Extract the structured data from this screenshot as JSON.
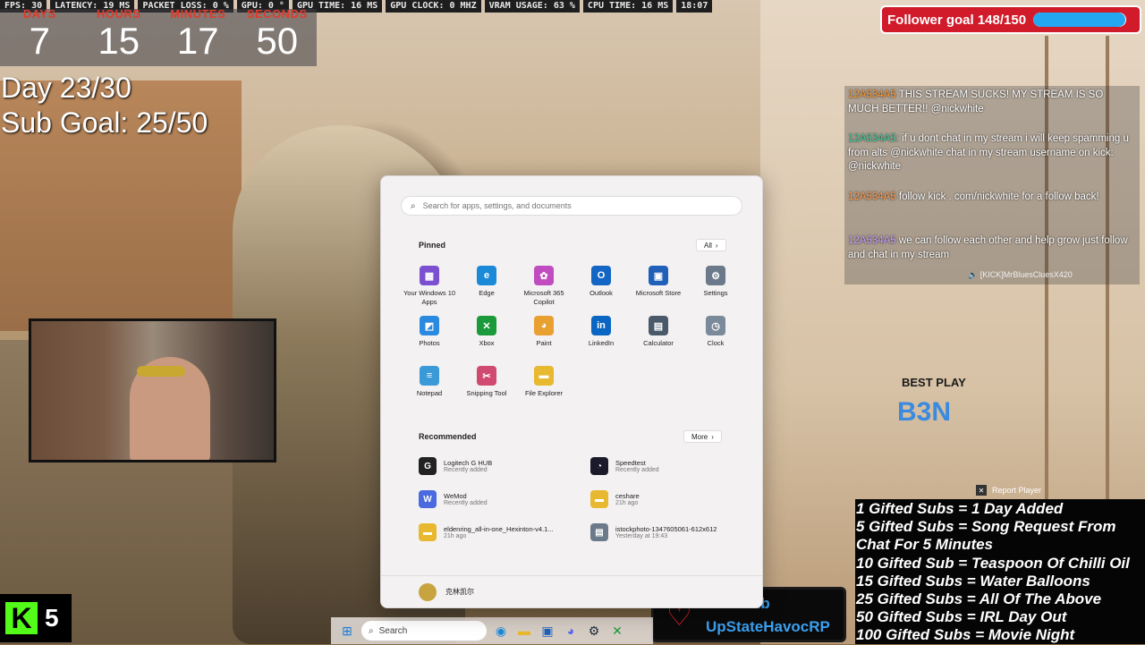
{
  "stats": [
    "FPS: 30",
    "LATENCY: 19 MS",
    "PACKET LOSS: 0 %",
    "GPU: 0 °",
    "GPU TIME: 16 MS",
    "GPU CLOCK: 0 MHZ",
    "VRAM USAGE: 63 %",
    "CPU TIME: 16 MS",
    "18:07"
  ],
  "countdown": [
    {
      "label": "DAYS",
      "value": "7"
    },
    {
      "label": "HOURS",
      "value": "15"
    },
    {
      "label": "MINUTES",
      "value": "17"
    },
    {
      "label": "SECONDS",
      "value": "50"
    }
  ],
  "day_counter": "Day 23/30",
  "sub_goal": "Sub Goal: 25/50",
  "follower_goal": {
    "label": "Follower goal 148/150",
    "progress": 0.987,
    "color": "#25a6f0"
  },
  "chat": {
    "messages": [
      {
        "user": "12A534A5",
        "text": "THIS STREAM SUCKS! MY STREAM IS SO MUCH BETTER!! @nickwhite"
      },
      {
        "user": "12A534A5:",
        "text": "if u dont chat in my stream i will keep spamming u from alts @nickwhite chat in my stream username on kick: @nickwhite"
      },
      {
        "user": "12A534A5",
        "text": "follow kick . com/nickwhite for a follow back!"
      },
      {
        "user": "12A534A5",
        "text": "we can follow each other and help grow just follow and chat in my stream"
      }
    ],
    "footer": "[KICK]MrBluesCluesX420"
  },
  "best_play": {
    "label": "BEST PLAY",
    "name": "B3N"
  },
  "report_player": "Report Player",
  "gifted_subs": [
    "1 Gifted Subs = 1 Day Added",
    "5 Gifted Subs =  Song Request From",
    "Chat For 5 Minutes",
    "10 Gifted Sub = Teaspoon Of Chilli Oil",
    "15 Gifted Subs = Water Balloons",
    "25 Gifted Subs = All Of The Above",
    "50 Gifted Subs = IRL Day Out",
    "100 Gifted Subs = Movie Night"
  ],
  "last_sub": {
    "label": "Last Sub",
    "name": "UpStateHavocRP"
  },
  "kick": {
    "count": "5"
  },
  "taskbar": {
    "search_label": "Search"
  },
  "start_menu": {
    "search_placeholder": "Search for apps, settings, and documents",
    "pinned_label": "Pinned",
    "all_label": "All",
    "pinned": [
      {
        "name": "Your Windows 10 Apps",
        "color": "#7a4fd0",
        "glyph": "▦"
      },
      {
        "name": "Edge",
        "color": "#1a8ad8",
        "glyph": "e"
      },
      {
        "name": "Microsoft 365 Copilot",
        "color": "#c04cc0",
        "glyph": "✿"
      },
      {
        "name": "Outlook",
        "color": "#1466c4",
        "glyph": "O"
      },
      {
        "name": "Microsoft Store",
        "color": "#2060b8",
        "glyph": "▣"
      },
      {
        "name": "Settings",
        "color": "#6a7a8a",
        "glyph": "⚙"
      },
      {
        "name": "Photos",
        "color": "#2a8ae0",
        "glyph": "◩"
      },
      {
        "name": "Xbox",
        "color": "#1a9a3a",
        "glyph": "✕"
      },
      {
        "name": "Paint",
        "color": "#e8a030",
        "glyph": "◕"
      },
      {
        "name": "LinkedIn",
        "color": "#0a66c2",
        "glyph": "in"
      },
      {
        "name": "Calculator",
        "color": "#4a5a6a",
        "glyph": "▤"
      },
      {
        "name": "Clock",
        "color": "#7a8a9a",
        "glyph": "◷"
      },
      {
        "name": "Notepad",
        "color": "#3a9ad8",
        "glyph": "≡"
      },
      {
        "name": "Snipping Tool",
        "color": "#d04a70",
        "glyph": "✂"
      },
      {
        "name": "File Explorer",
        "color": "#e8b830",
        "glyph": "▬"
      }
    ],
    "recommended_label": "Recommended",
    "more_label": "More",
    "recommended": [
      {
        "name": "Logitech G HUB",
        "sub": "Recently added",
        "color": "#222222",
        "glyph": "G"
      },
      {
        "name": "Speedtest",
        "sub": "Recently added",
        "color": "#1a1a2a",
        "glyph": "◔"
      },
      {
        "name": "WeMod",
        "sub": "Recently added",
        "color": "#4a6ae0",
        "glyph": "W"
      },
      {
        "name": "ceshare",
        "sub": "21h ago",
        "color": "#e8b830",
        "glyph": "▬"
      },
      {
        "name": "eldenring_all-in-one_Hexinton-v4.1...",
        "sub": "21h ago",
        "color": "#e8b830",
        "glyph": "▬"
      },
      {
        "name": "istockphoto-1347605061-612x612",
        "sub": "Yesterday at 19:43",
        "color": "#6a7a8a",
        "glyph": "▤"
      }
    ],
    "user_name": "克林凯尔"
  }
}
